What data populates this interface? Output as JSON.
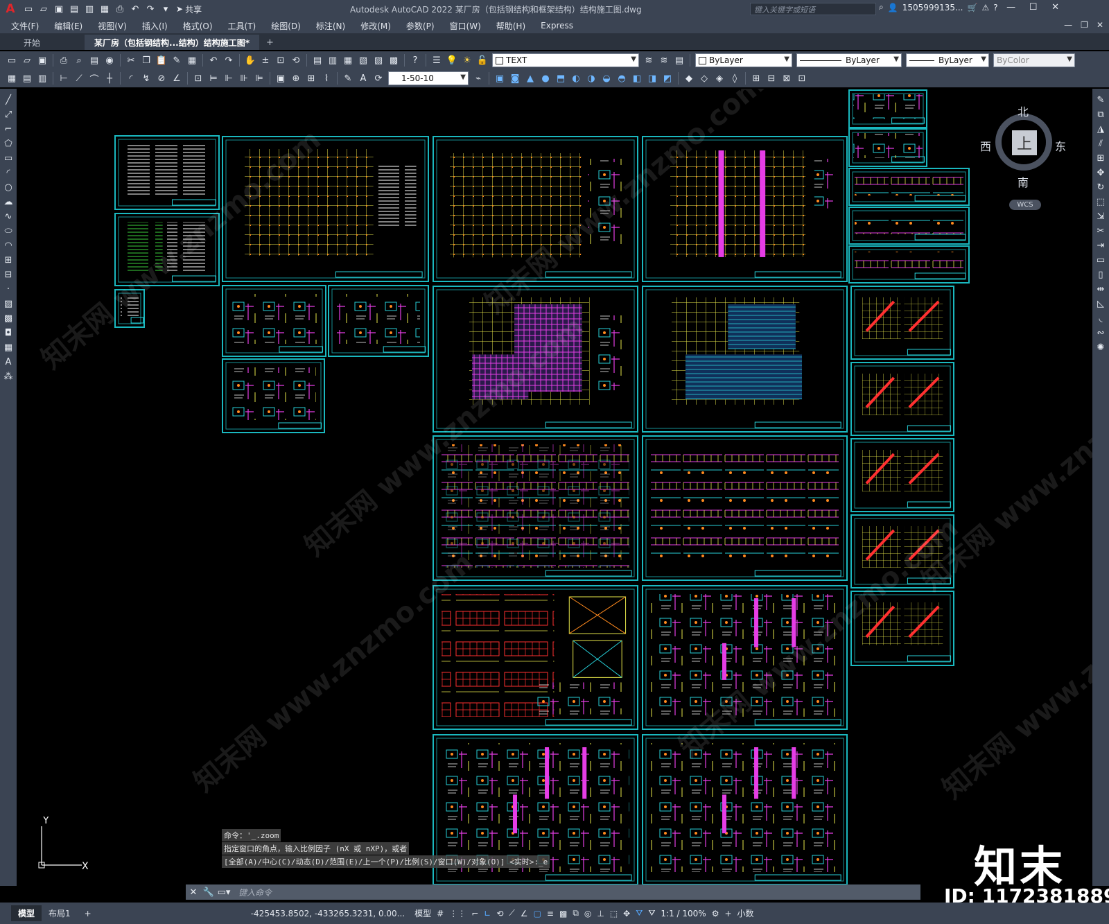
{
  "app": {
    "logo": "A",
    "window_title": "Autodesk AutoCAD 2022    某厂房（包括钢结构和框架结构）结构施工图.dwg",
    "share_label": "共享",
    "search_placeholder": "键入关键字或短语",
    "user_name": "1505999135...",
    "help_icon": "?"
  },
  "menu": [
    "文件(F)",
    "编辑(E)",
    "视图(V)",
    "插入(I)",
    "格式(O)",
    "工具(T)",
    "绘图(D)",
    "标注(N)",
    "修改(M)",
    "参数(P)",
    "窗口(W)",
    "帮助(H)",
    "Express"
  ],
  "tabs": [
    {
      "label": "开始"
    },
    {
      "label": "某厂房（包括钢结构...结构）结构施工图*"
    }
  ],
  "toolbar": {
    "text_style": "TEXT",
    "layer": "ByLayer",
    "linetype": "ByLayer",
    "lineweight": "ByLayer",
    "plotstyle": "ByColor",
    "scale": "1-50-10"
  },
  "viewcube": {
    "north": "北",
    "south": "南",
    "east": "东",
    "west": "西",
    "face": "上",
    "wcs": "WCS"
  },
  "ucs": {
    "y": "Y",
    "x": "X"
  },
  "command": {
    "history": [
      "命令：'_.zoom",
      "指定窗口的角点，输入比例因子 (nX 或 nXP)，或者",
      "[全部(A)/中心(C)/动态(D)/范围(E)/上一个(P)/比例(S)/窗口(W)/对象(O)] <实时>:_e"
    ],
    "input_placeholder": "键入命令"
  },
  "status": {
    "layout_tabs": [
      "模型",
      "布局1"
    ],
    "coords": "-425453.8502, -433265.3231, 0.00...",
    "model_label": "模型",
    "scale": "1:1 / 100%",
    "units": "小数"
  },
  "watermark": {
    "brand": "知末",
    "id": "ID: 1172381889",
    "site": "知末网 www.znzmo.com"
  },
  "colors": {
    "frame": "#1ab8bf",
    "grid": "#e8e84a",
    "column": "#ff8a1e",
    "magenta": "#e63de6",
    "cyan": "#27d0d8",
    "white": "#ffffff",
    "green": "#3cd13c"
  }
}
